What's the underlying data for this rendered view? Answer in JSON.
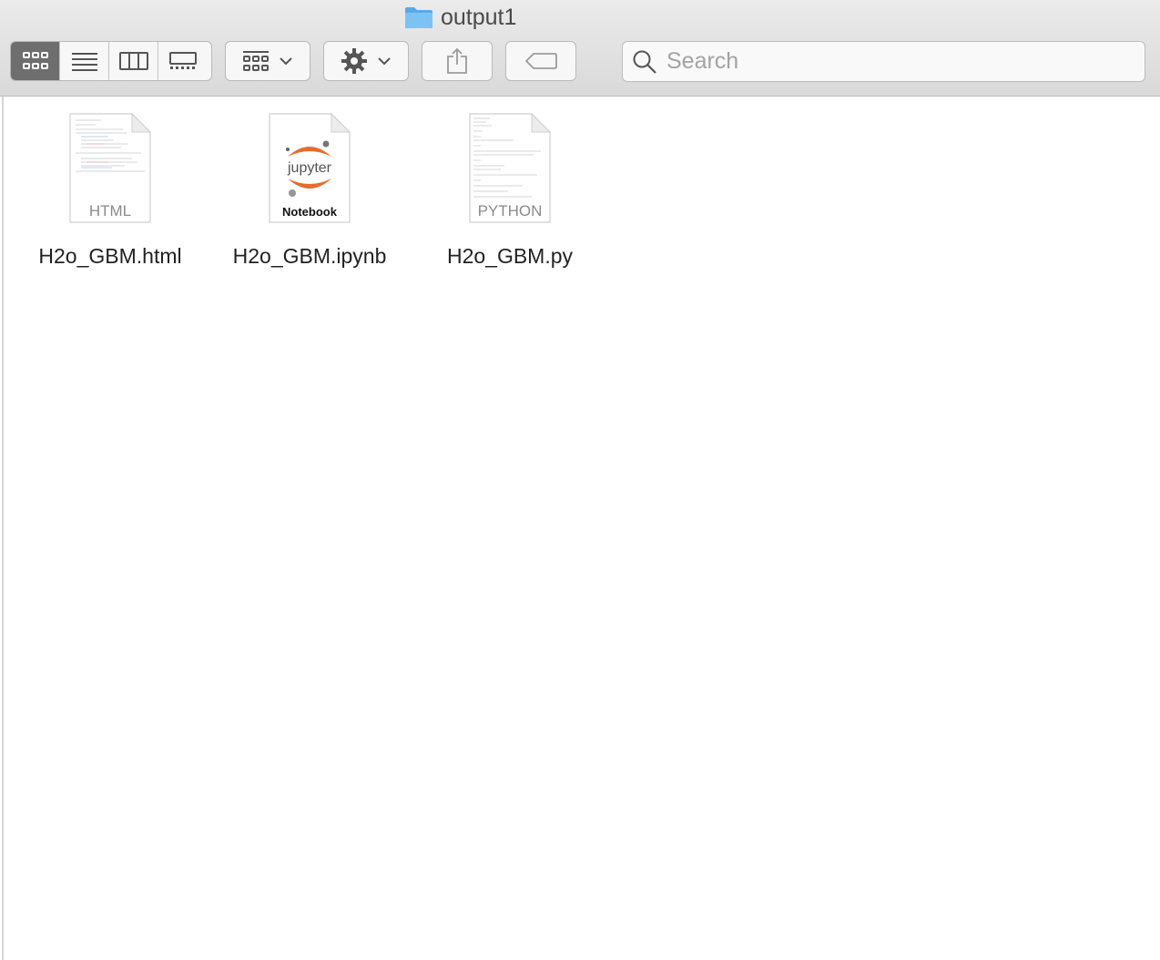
{
  "window": {
    "title": "output1"
  },
  "toolbar": {
    "view_modes": [
      "icon-view",
      "list-view",
      "column-view",
      "gallery-view"
    ],
    "active_view": "icon-view",
    "group_button": "group-by",
    "action_button": "action-gear",
    "share_button": "share",
    "tags_button": "tags"
  },
  "search": {
    "placeholder": "Search",
    "value": ""
  },
  "files": [
    {
      "name": "H2o_GBM.html",
      "type_label": "HTML"
    },
    {
      "name": "H2o_GBM.ipynb",
      "logo_text": "jupyter",
      "type_label": "Notebook"
    },
    {
      "name": "H2o_GBM.py",
      "type_label": "PYTHON"
    }
  ],
  "colors": {
    "jupyter_orange": "#e46e2e",
    "folder_blue": "#68b6ef",
    "active_segment": "#6e6e6e"
  }
}
